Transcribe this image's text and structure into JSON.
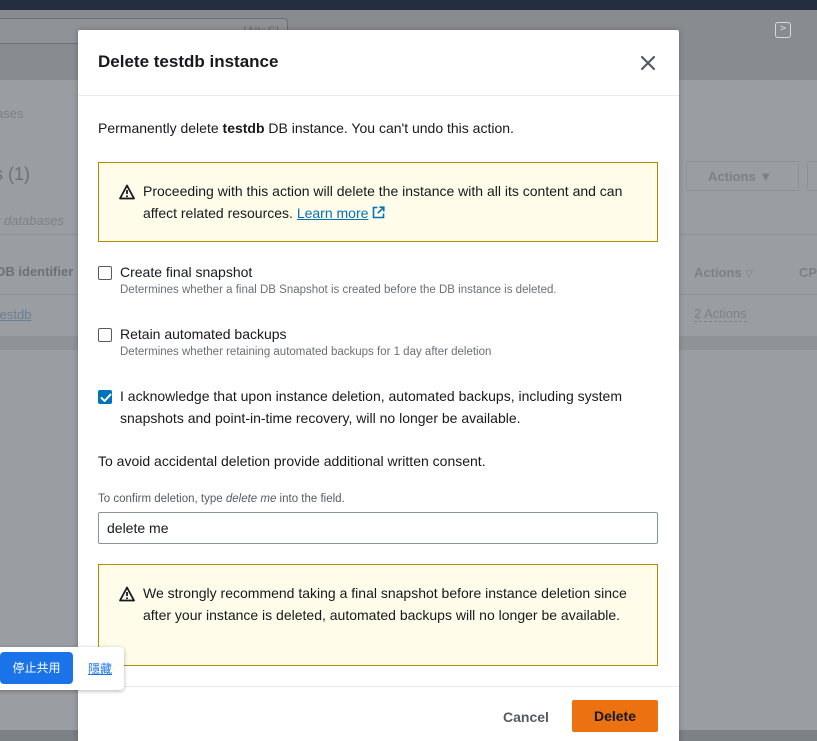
{
  "background": {
    "search_hint": "[Alt+S]",
    "breadcrumb": "ases",
    "heading": "s (1)",
    "filter_placeholder": "r databases",
    "actions_button": "Actions",
    "columns": {
      "id": "DB identifier",
      "actions": "Actions",
      "cpu": "CP"
    },
    "row": {
      "db": "testdb",
      "actions": "2 Actions"
    }
  },
  "modal": {
    "title": "Delete testdb instance",
    "intro": {
      "prefix": "Permanently delete ",
      "name": "testdb",
      "suffix": " DB instance. You can't undo this action."
    },
    "warning_1": {
      "text": "Proceeding with this action will delete the instance with all its content and can affect related resources. ",
      "link": "Learn more"
    },
    "options": [
      {
        "label": "Create final snapshot",
        "description": "Determines whether a final DB Snapshot is created before the DB instance is deleted.",
        "checked": false
      },
      {
        "label": "Retain automated backups",
        "description": "Determines whether retaining automated backups for 1 day after deletion",
        "checked": false
      },
      {
        "label": "I acknowledge that upon instance deletion, automated backups, including system snapshots and point-in-time recovery, will no longer be available.",
        "checked": true
      }
    ],
    "consent_text": "To avoid accidental deletion provide additional written consent.",
    "confirm": {
      "prefix": "To confirm deletion, type ",
      "phrase": "delete me",
      "suffix": " into the field.",
      "value": "delete me"
    },
    "warning_2": "We strongly recommend taking a final snapshot before instance deletion since after your instance is deleted, automated backups will no longer be available.",
    "cancel_label": "Cancel",
    "delete_label": "Delete"
  },
  "share_bar": {
    "stop_label": "停止共用",
    "hide_label": "隱藏"
  },
  "colors": {
    "accent": "#ec7211",
    "link": "#0073bb",
    "warning_border": "#b58a02",
    "warning_bg": "#fffce9",
    "checkbox": "#0073bb"
  }
}
